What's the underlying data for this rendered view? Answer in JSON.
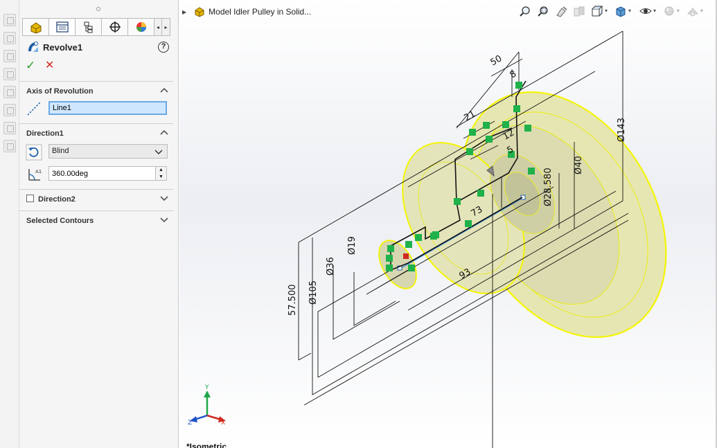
{
  "property_manager": {
    "feature_title": "Revolve1",
    "help_symbol": "?",
    "ok_symbol": "✓",
    "cancel_symbol": "✕",
    "tab_nav_left": "◂",
    "tab_nav_right": "▸",
    "tabs": [
      {
        "icon": "part-icon"
      },
      {
        "icon": "property-manager-icon"
      },
      {
        "icon": "configuration-manager-icon"
      },
      {
        "icon": "dimxpert-icon"
      },
      {
        "icon": "appearance-icon"
      }
    ],
    "axis_of_revolution": {
      "title": "Axis of Revolution",
      "value": "Line1"
    },
    "direction1": {
      "title": "Direction1",
      "end_condition": "Blind",
      "angle": "360.00deg"
    },
    "direction2": {
      "title": "Direction2",
      "checked": false
    },
    "selected_contours": {
      "title": "Selected Contours"
    }
  },
  "graphics": {
    "tree_flyout_label": "Model Idler Pulley in Solid...",
    "view_orientation": "*Isometric",
    "triad": {
      "x": "X",
      "y": "Y",
      "z": "Z"
    },
    "dimensions": [
      {
        "label": "50"
      },
      {
        "label": "8"
      },
      {
        "label": "21"
      },
      {
        "label": "12"
      },
      {
        "label": "5"
      },
      {
        "label": "Ø143"
      },
      {
        "label": "Ø40"
      },
      {
        "label": "Ø28.580"
      },
      {
        "label": "73"
      },
      {
        "label": "93"
      },
      {
        "label": "Ø36"
      },
      {
        "label": "Ø19"
      },
      {
        "label": "Ø105"
      },
      {
        "label": "57.500"
      }
    ],
    "heads_up_toolbar": [
      "zoom-to-fit-icon",
      "zoom-to-area-icon",
      "previous-view-icon",
      "section-view-icon",
      "view-orientation-icon",
      "display-style-icon",
      "hide-show-items-icon",
      "edit-appearance-icon",
      "apply-scene-icon"
    ],
    "colors": {
      "part_fill": "#e8e8b6",
      "silhouette": "#f4f500",
      "dimension": "#111111",
      "relation_marker": "#1fb14a",
      "axis": "#3a8fd6"
    }
  }
}
